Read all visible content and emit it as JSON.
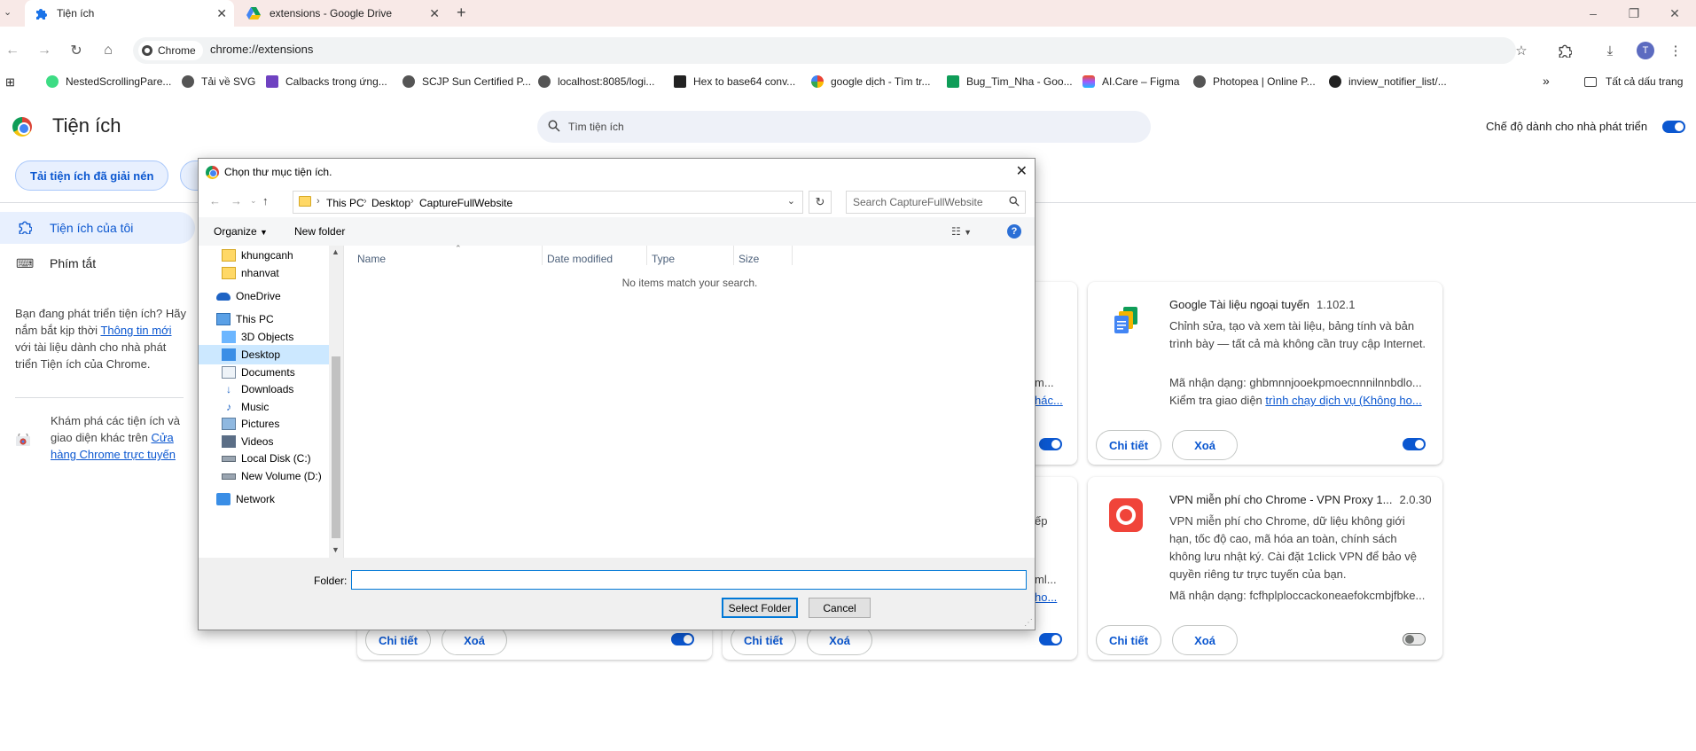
{
  "browser": {
    "tabs": [
      {
        "title": "Tiện ích",
        "icon": "puzzle-icon"
      },
      {
        "title": "extensions - Google Drive",
        "icon": "google-drive-icon"
      }
    ],
    "new_tab_symbol": "+",
    "site_chip": "Chrome",
    "url": "chrome://extensions",
    "bookmarks": [
      "NestedScrollingPare...",
      "Tải về SVG",
      "Calbacks trong ứng...",
      "SCJP Sun Certified P...",
      "localhost:8085/logi...",
      "Hex to base64 conv...",
      "google dịch - Tìm tr...",
      "Bug_Tim_Nha - Goo...",
      "AI.Care – Figma",
      "Photopea | Online P...",
      "inview_notifier_list/..."
    ],
    "all_bookmarks": "Tất cả dấu trang",
    "more_bookmarks": "»",
    "profile_initial": "T"
  },
  "page": {
    "title": "Tiện ích",
    "search_placeholder": "Tìm tiện ích",
    "dev_mode_label": "Chế độ dành cho nhà phát triển",
    "load_unpacked": "Tải tiện ích đã giải nén",
    "sidebar": [
      {
        "label": "Tiện ích của tôi",
        "icon": "extension-icon"
      },
      {
        "label": "Phím tắt",
        "icon": "keyboard-icon"
      }
    ],
    "dev_note": {
      "before": "Bạn đang phát triển tiện ích? Hãy nắm bắt kịp thời ",
      "link": "Thông tin mới",
      "after": " với tài liệu dành cho nhà phát triển Tiện ích của Chrome."
    },
    "store_note": {
      "before": "Khám phá các tiện ích và giao diện khác trên ",
      "link": "Cửa hàng Chrome trực tuyến"
    },
    "details_label": "Chi tiết",
    "remove_label": "Xoá",
    "cards": [
      {
        "name": "Google Tài liệu ngoại tuyến",
        "version": "1.102.1",
        "description": "Chỉnh sửa, tạo và xem tài liệu, bảng tính và bản trình bày — tất cả mà không cần truy cập Internet.",
        "id_line": "Mã nhận dạng: ghbmnnjooekpmoecnnnilnnbdlo...",
        "inspect_prefix": "Kiểm tra giao diện ",
        "inspect_link": "trình chạy dịch vụ (Không ho...",
        "enabled": true
      },
      {
        "name": "VPN miễn phí cho Chrome - VPN Proxy 1...",
        "version": "2.0.30",
        "description": "VPN miễn phí cho Chrome, dữ liệu không giới hạn, tốc độ cao, mã hóa an toàn, chính sách không lưu nhật ký. Cài đặt 1click VPN để bảo vệ quyền riêng tư trực tuyến của bạn.",
        "id_line": "Mã nhận dạng: fcfhplploccackoneaefokcmbjfbke...",
        "enabled": false
      }
    ],
    "partial_text": {
      "m1": "m...",
      "m2": "hác...",
      "m3": "ếp",
      "m4": "ml...",
      "m5": "ho..."
    }
  },
  "dialog": {
    "title": "Chọn thư mục tiện ích.",
    "breadcrumb": [
      "This PC",
      "Desktop",
      "CaptureFullWebsite"
    ],
    "search_placeholder": "Search CaptureFullWebsite",
    "organize": "Organize",
    "new_folder": "New folder",
    "tree": [
      {
        "label": "khungcanh",
        "icon": "folder-icon"
      },
      {
        "label": "nhanvat",
        "icon": "folder-icon"
      },
      {
        "label": "OneDrive",
        "icon": "onedrive-icon"
      },
      {
        "label": "This PC",
        "icon": "computer-icon"
      },
      {
        "label": "3D Objects",
        "icon": "3d-objects-icon"
      },
      {
        "label": "Desktop",
        "icon": "desktop-icon"
      },
      {
        "label": "Documents",
        "icon": "documents-icon"
      },
      {
        "label": "Downloads",
        "icon": "downloads-icon"
      },
      {
        "label": "Music",
        "icon": "music-icon"
      },
      {
        "label": "Pictures",
        "icon": "pictures-icon"
      },
      {
        "label": "Videos",
        "icon": "videos-icon"
      },
      {
        "label": "Local Disk (C:)",
        "icon": "drive-icon"
      },
      {
        "label": "New Volume (D:)",
        "icon": "drive-icon"
      },
      {
        "label": "Network",
        "icon": "network-icon"
      }
    ],
    "selected_tree_item": "Desktop",
    "columns": [
      "Name",
      "Date modified",
      "Type",
      "Size"
    ],
    "empty_message": "No items match your search.",
    "folder_label": "Folder:",
    "folder_value": "",
    "select_button": "Select Folder",
    "cancel_button": "Cancel"
  },
  "colors": {
    "accent": "#0b57d0",
    "tabstrip": "#f8e9e7",
    "selection": "#cce8ff",
    "vpn_brand": "#f0443a"
  }
}
